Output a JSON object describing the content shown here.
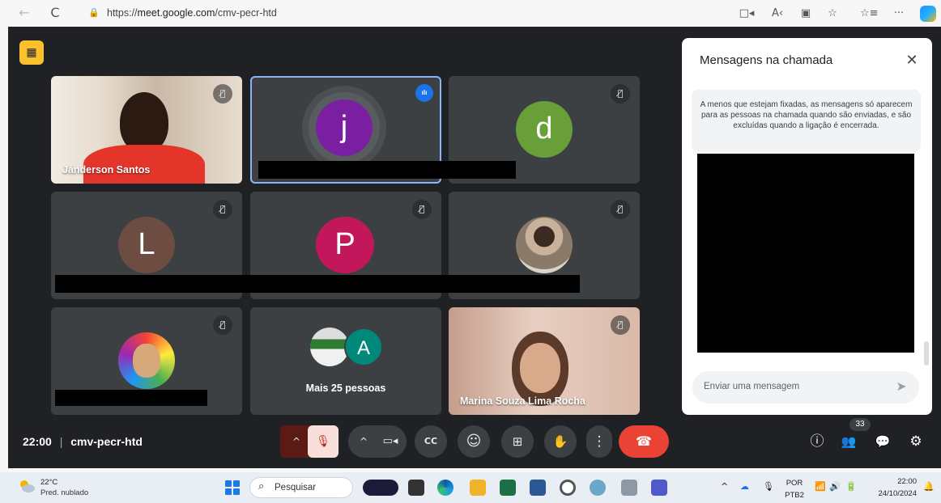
{
  "browser": {
    "back_icon": "←",
    "reload_icon": "C",
    "lock_icon": "🔒",
    "url_prefix": "https://",
    "url_domain": "meet.google.com",
    "url_path": "/cmv-pecr-htd",
    "right_icons": [
      "□◂",
      "A‹",
      "▣",
      "☆",
      "☆≡",
      "···"
    ]
  },
  "meet": {
    "corner_badge_icon": "▦",
    "tiles": [
      {
        "name": "Jánderson Santos"
      },
      {
        "initial": "j"
      },
      {
        "initial": "d"
      },
      {
        "initial": "L"
      },
      {
        "initial": "P"
      },
      {},
      {},
      {
        "extra_initial": "A",
        "label": "Mais 25 pessoas"
      },
      {
        "name": "Marina Souza Lima Rocha"
      }
    ],
    "mic_off_icon": "🎙̸",
    "speaking_icon": "ılı"
  },
  "chat": {
    "title": "Mensagens na chamada",
    "close_icon": "✕",
    "note": "A menos que estejam fixadas, as mensagens só aparecem para as pessoas na chamada quando são enviadas, e são excluídas quando a ligação é encerrada.",
    "input_placeholder": "Enviar uma mensagem",
    "send_icon": "➤"
  },
  "bottom": {
    "time": "22:00",
    "separator": "|",
    "meeting_code": "cmv-pecr-htd",
    "controls": {
      "mic_chevron": "^",
      "mic_off": "🎙",
      "cam_chevron": "^",
      "camera": "▭◂",
      "captions": "CC",
      "emoji": "☺",
      "present": "⊞",
      "raise_hand": "✋",
      "more": "⋮",
      "leave": "☎"
    },
    "info_icon": "ⓘ",
    "people_icon": "👥",
    "people_count": "33",
    "chat_icon": "💬",
    "activities_icon": "⚙"
  },
  "taskbar": {
    "temp": "22°C",
    "weather": "Pred. nublado",
    "search_label": "Pesquisar",
    "search_icon": "⌕",
    "lang_top": "POR",
    "lang_bottom": "PTB2",
    "clock_time": "22:00",
    "clock_date": "24/10/2024",
    "tray_icons": [
      "^",
      "☁",
      "🎙",
      "📶",
      "🔊",
      "🔋",
      "🔔"
    ]
  }
}
